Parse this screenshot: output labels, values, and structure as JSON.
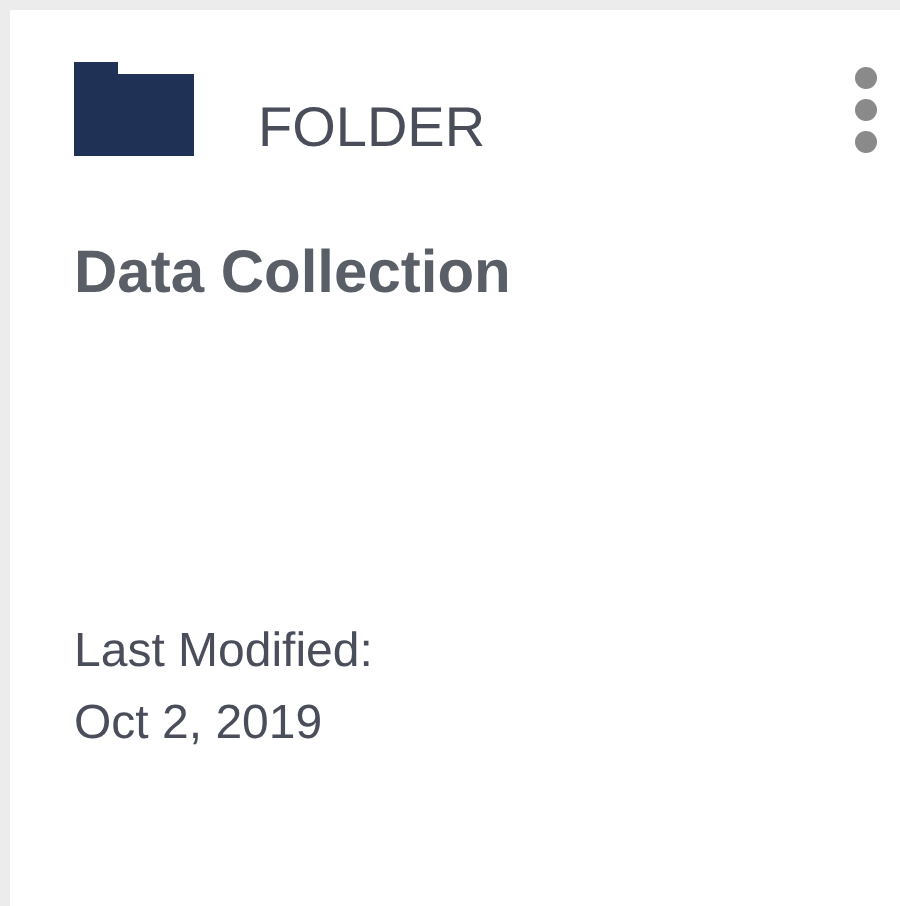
{
  "card": {
    "kind": "folder",
    "type_label": "FOLDER",
    "title": "Data Collection",
    "modified_label": "Last Modified:",
    "modified_date": "Oct 2, 2019"
  }
}
